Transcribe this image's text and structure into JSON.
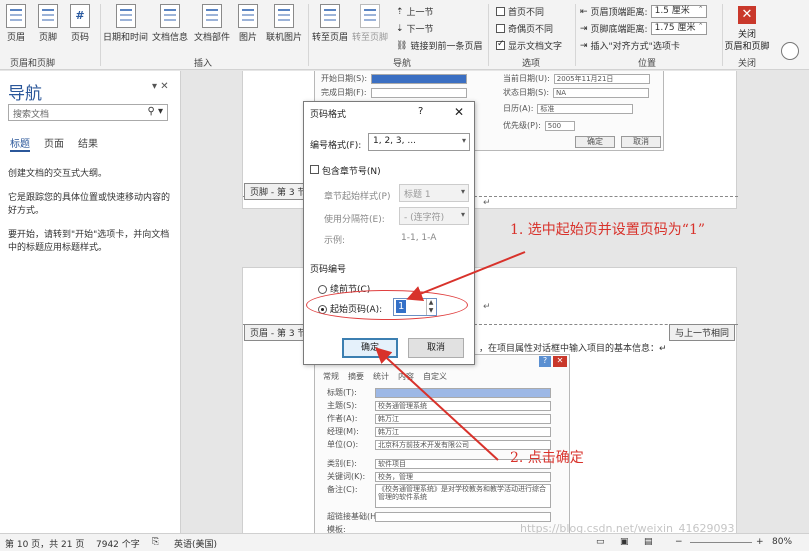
{
  "ribbon": {
    "buttons": [
      "页眉",
      "页脚",
      "页码",
      "日期和时间",
      "文档信息",
      "文档部件",
      "图片",
      "联机图片",
      "转至页眉",
      "转至页脚"
    ],
    "nav_items": [
      "上一节",
      "下一节",
      "链接到前一条页眉"
    ],
    "options": [
      {
        "label": "首页不同",
        "checked": false
      },
      {
        "label": "奇偶页不同",
        "checked": false
      },
      {
        "label": "显示文档文字",
        "checked": true
      }
    ],
    "position": [
      {
        "label": "页眉顶端距离:",
        "value": "1.5 厘米"
      },
      {
        "label": "页脚底端距离:",
        "value": "1.75 厘米"
      }
    ],
    "insert_align_tab": "插入\"对齐方式\"选项卡",
    "close_label": "关闭\n页眉和页脚",
    "groups": [
      "页眉和页脚",
      "插入",
      "导航",
      "选项",
      "位置",
      "关闭"
    ]
  },
  "nav": {
    "title": "导航",
    "search_placeholder": "搜索文档",
    "tabs": [
      "标题",
      "页面",
      "结果"
    ],
    "text1": "创建文档的交互式大纲。",
    "text2": "它是跟踪您的具体位置或快速移动内容的好方式。",
    "text3": "要开始，请转到\"开始\"选项卡，并向文档中的标题应用标题样式。"
  },
  "doc": {
    "footer_tag": "页脚 - 第 3 节",
    "header_tag": "页眉 - 第 3 节",
    "same_as_prev": "与上一节相同",
    "body_text": "，在项目属性对话框中输入项目的基本信息：↵",
    "top_embed": {
      "labels": [
        "开始日期(S):",
        "完成日期(F):",
        "当前日期(U):",
        "状态日期(S):",
        "日历(A):",
        "优先级(P):"
      ],
      "values": [
        "2005年11月21日",
        "NA",
        "标准",
        "500"
      ],
      "ok": "确定",
      "cancel": "取消"
    },
    "props_embed": {
      "tabs": [
        "常规",
        "摘要",
        "统计",
        "内容",
        "自定义"
      ],
      "labels": [
        "标题(T):",
        "主题(S):",
        "作者(A):",
        "经理(M):",
        "单位(O):",
        "类别(E):",
        "关键词(K):",
        "备注(C):",
        "超链接基础(H):",
        "模板:"
      ],
      "values": [
        "",
        "校务通管理系统",
        "韩万江",
        "韩万江",
        "北京科方前技术开发有限公司",
        "软件项目",
        "校务，管理",
        "《校务通管理系统》是对学校教务和教学活动进行综合管理的软件系统"
      ]
    }
  },
  "dialog": {
    "title": "页码格式",
    "help": "?",
    "number_format_label": "编号格式(F):",
    "number_format_value": "1, 2, 3, ...",
    "include_chapter": "包含章节号(N)",
    "chapter_style_label": "章节起始样式(P)",
    "chapter_style_value": "标题 1",
    "separator_label": "使用分隔符(E):",
    "separator_value": "-  (连字符)",
    "example_label": "示例:",
    "example_value": "1-1, 1-A",
    "section_title": "页码编号",
    "continue_label": "续前节(C)",
    "start_at_label": "起始页码(A):",
    "start_at_value": "1",
    "ok": "确定",
    "cancel": "取消"
  },
  "annotations": {
    "step1": "1. 选中起始页并设置页码为“1”",
    "step2": "2. 点击确定"
  },
  "status": {
    "page": "第 10 页，共 21 页",
    "words": "7942 个字",
    "lang": "英语(美国)",
    "zoom": "80%",
    "watermark": "https://blog.csdn.net/weixin_41629093"
  },
  "colors": {
    "accent": "#2b579a",
    "annotation": "#d8322b",
    "close": "#c9382b"
  }
}
